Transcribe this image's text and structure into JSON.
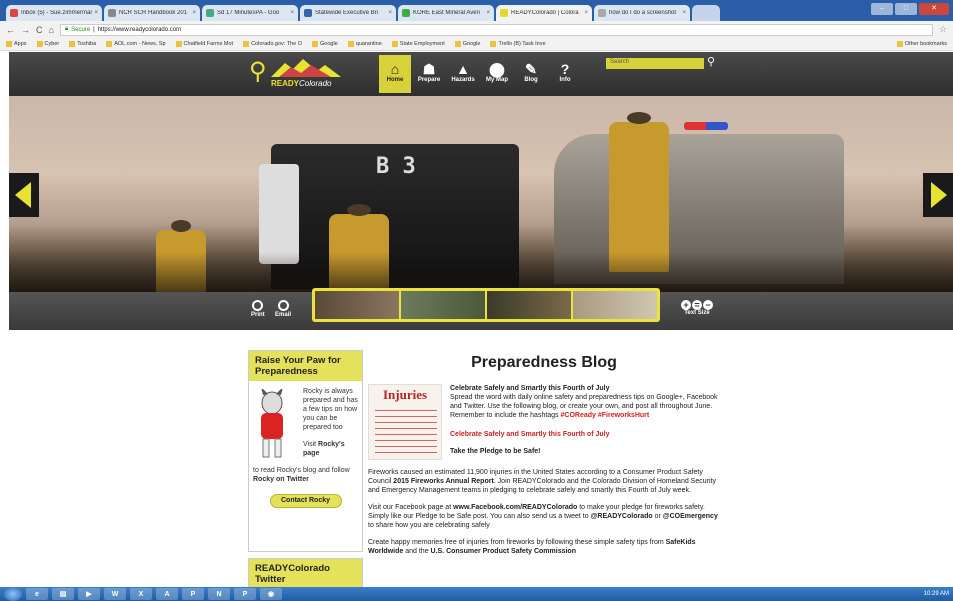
{
  "browser": {
    "tabs": [
      {
        "title": "Inbox (5) - Sue.zimmerman",
        "color": "#d44"
      },
      {
        "title": "NCR SCR Handbook 201",
        "color": "#888"
      },
      {
        "title": "Sd 17 MinutesPA - Goo",
        "color": "#4a8"
      },
      {
        "title": "Statewide Executive Bri",
        "color": "#36a"
      },
      {
        "title": "KORE East Mineral Aven",
        "color": "#4a4"
      },
      {
        "title": "READYColorado | Colora",
        "color": "#e5d630",
        "active": true
      },
      {
        "title": "how do I do a screenshot",
        "color": "#aaa"
      }
    ],
    "url_secure_label": "Secure",
    "url": "https://www.readycolorado.com",
    "bookmarks": [
      "Apps",
      "Cyber",
      "Toshiba",
      "AOL.com - News, Sp",
      "Chatfield Farms Mot",
      "Colorado.gov: The O",
      "Google",
      "quarantine",
      "State Employment",
      "Google",
      "Trello (B) Task Inve"
    ],
    "other_bookmarks": "Other bookmarks"
  },
  "site": {
    "logo_ready": "READY",
    "logo_colorado": "Colorado",
    "nav": [
      {
        "label": "Home",
        "icon": "home-icon",
        "glyph": "⌂",
        "active": true
      },
      {
        "label": "Prepare",
        "icon": "prepare-icon",
        "glyph": "☗"
      },
      {
        "label": "Hazards",
        "icon": "hazards-icon",
        "glyph": "▲"
      },
      {
        "label": "My Map",
        "icon": "map-pin-icon",
        "glyph": "⬤"
      },
      {
        "label": "Blog",
        "icon": "blog-icon",
        "glyph": "✎"
      },
      {
        "label": "Info",
        "icon": "info-icon",
        "glyph": "?"
      }
    ],
    "search_placeholder": "Search"
  },
  "hero": {
    "truck_label": "B 3",
    "print_label": "Print",
    "email_label": "Email",
    "text_size_label": "Text Size"
  },
  "sidebar": {
    "paw_title": "Raise Your Paw for Preparedness",
    "rocky_text": "Rocky is always prepared and has a few tips on how you can be prepared too",
    "visit_prefix": "Visit ",
    "visit_link": "Rocky's page",
    "visit_suffix": " to read Rocky's blog and follow ",
    "twitter_link": "Rocky on Twitter",
    "contact_button": "Contact Rocky",
    "twitter_title": "READYColorado Twitter"
  },
  "blog": {
    "title": "Preparedness Blog",
    "image_heading": "Injuries",
    "post_heading": "Celebrate Safely and Smartly this Fourth of July",
    "post_intro": "Spread the word with daily online safety and preparedness tips on Google+, Facebook and Twitter. Use the following blog, or create your own, and post all throughout June. Remember to include the hashtags ",
    "hashtags": "#COReady #FireworksHurt",
    "red_heading": "Celebrate Safely and Smartly this Fourth of July",
    "pledge": "Take the Pledge to be Safe!",
    "para1_a": "Fireworks caused an estimated 11,900 injuries in the United States according to a Consumer Product Safety Council ",
    "para1_b": "2015 Fireworks Annual Report",
    "para1_c": ". Join READYColorado and the Colorado Division of Homeland Security and Emergency Management teams in pledging to celebrate safely and smartly this Fourth of July week.",
    "para2_a": "Visit our Facebook page at ",
    "para2_b": "www.Facebook.com/READYColorado",
    "para2_c": " to make your pledge for fireworks safety. Simply like our Pledge to be Safe post. You can also send us a tweet to ",
    "para2_d": "@READYColorado",
    "para2_e": " or ",
    "para2_f": "@COEmergency",
    "para2_g": " to share how you are celebrating safely",
    "para3_a": "Create happy memories free of injuries from fireworks by following these simple safety tips from ",
    "para3_b": "SafeKids Worldwide",
    "para3_c": " and the ",
    "para3_d": "U.S. Consumer Product Safety Commission"
  },
  "taskbar": {
    "apps": [
      "e",
      "▤",
      "▶",
      "W",
      "X",
      "A",
      "P",
      "N",
      "P",
      "◉"
    ],
    "clock": "10:29 AM"
  }
}
